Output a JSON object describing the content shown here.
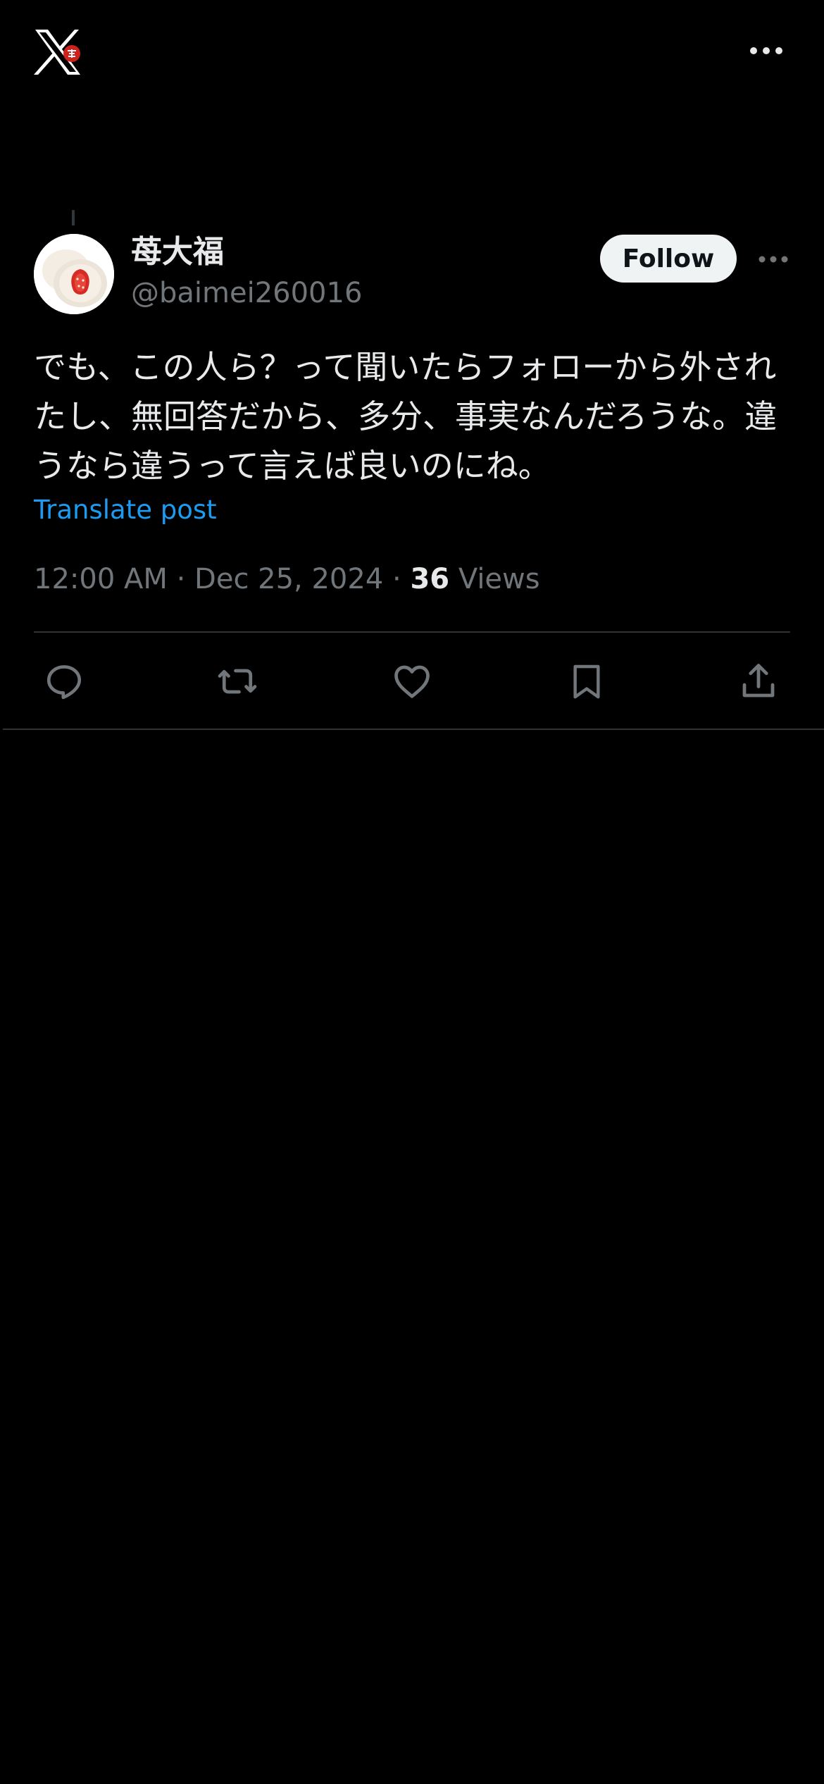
{
  "header": {
    "logo_icon": "x-logo-icon",
    "more_icon": "more-horizontal-icon"
  },
  "post": {
    "author": {
      "display_name": "苺大福",
      "handle": "@baimei260016",
      "avatar_icon": "strawberry-daifuku-avatar"
    },
    "follow_label": "Follow",
    "text": "でも、この人ら？って聞いたらフォローから外されたし、無回答だから、多分、事実なんだろうな。違うなら違うって言えば良いのにね。",
    "translate_label": "Translate post",
    "time": "12:00 AM",
    "separator": "·",
    "date": "Dec 25, 2024",
    "views_count": "36",
    "views_label": "Views"
  },
  "actions": [
    {
      "name": "reply",
      "icon": "reply-icon"
    },
    {
      "name": "repost",
      "icon": "repost-icon"
    },
    {
      "name": "like",
      "icon": "like-icon"
    },
    {
      "name": "bookmark",
      "icon": "bookmark-icon"
    },
    {
      "name": "share",
      "icon": "share-icon"
    }
  ],
  "colors": {
    "background": "#000000",
    "text_primary": "#e7e9ea",
    "text_secondary": "#71767b",
    "link": "#1d9bf0",
    "divider": "#2f3336",
    "follow_bg": "#eff3f4"
  }
}
